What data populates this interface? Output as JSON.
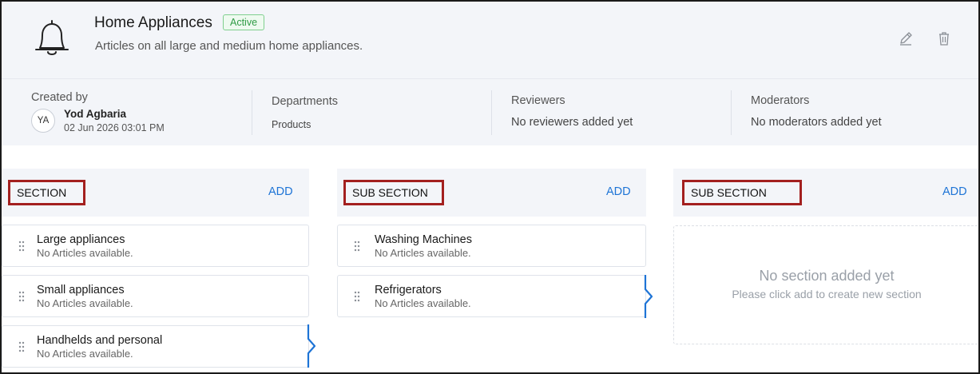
{
  "category": {
    "title": "Home Appliances",
    "status": "Active",
    "description": "Articles on all large and medium home appliances.",
    "icon": "bell-icon"
  },
  "meta": {
    "created_by_label": "Created by",
    "creator_initials": "YA",
    "creator_name": "Yod Agbaria",
    "created_date": "02 Jun 2026 03:01 PM",
    "departments_label": "Departments",
    "departments_value": "Products",
    "reviewers_label": "Reviewers",
    "reviewers_value": "No reviewers added yet",
    "moderators_label": "Moderators",
    "moderators_value": "No moderators added yet"
  },
  "columns": [
    {
      "title": "SECTION",
      "add_label": "ADD",
      "items": [
        {
          "title": "Large appliances",
          "subtitle": "No Articles available."
        },
        {
          "title": "Small appliances",
          "subtitle": "No Articles available."
        },
        {
          "title": "Handhelds and personal",
          "subtitle": "No Articles available."
        }
      ]
    },
    {
      "title": "SUB SECTION",
      "add_label": "ADD",
      "items": [
        {
          "title": "Washing Machines",
          "subtitle": "No Articles available."
        },
        {
          "title": "Refrigerators",
          "subtitle": "No Articles available."
        }
      ]
    },
    {
      "title": "SUB SECTION",
      "add_label": "ADD",
      "empty_title": "No section added yet",
      "empty_subtitle": "Please click add to create new section"
    }
  ],
  "colors": {
    "accent": "#1e74d6",
    "highlight_box": "#a3201f",
    "active_badge": "#2f9b45"
  }
}
